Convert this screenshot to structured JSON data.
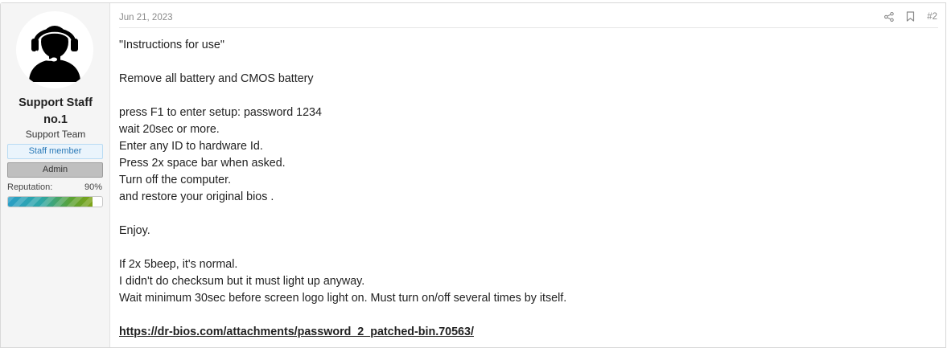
{
  "user": {
    "name_line1": "Support Staff",
    "name_line2": "no.1",
    "title": "Support Team",
    "banners": {
      "staff": "Staff member",
      "admin": "Admin"
    },
    "reputation": {
      "label": "Reputation:",
      "value": "90%",
      "fraction": 0.9
    },
    "avatar": "headset-support-avatar"
  },
  "post": {
    "date": "Jun 21, 2023",
    "number": "#2",
    "actions": [
      "share-icon",
      "bookmark-icon"
    ],
    "lines": [
      "\"Instructions for use\"",
      "",
      "Remove all battery and CMOS battery",
      "",
      "press F1 to enter setup: password 1234",
      "wait 20sec or more.",
      "Enter any ID to hardware Id.",
      "Press 2x space bar when asked.",
      "Turn off the computer.",
      "and restore your original bios .",
      "",
      "Enjoy.",
      "",
      "If 2x 5beep, it's normal.",
      "I didn't do checksum but it must light up anyway.",
      "Wait minimum 30sec before screen logo light on. Must turn on/off several times by itself.",
      ""
    ],
    "link": "https://dr-bios.com/attachments/password_2_patched-bin.70563/"
  }
}
